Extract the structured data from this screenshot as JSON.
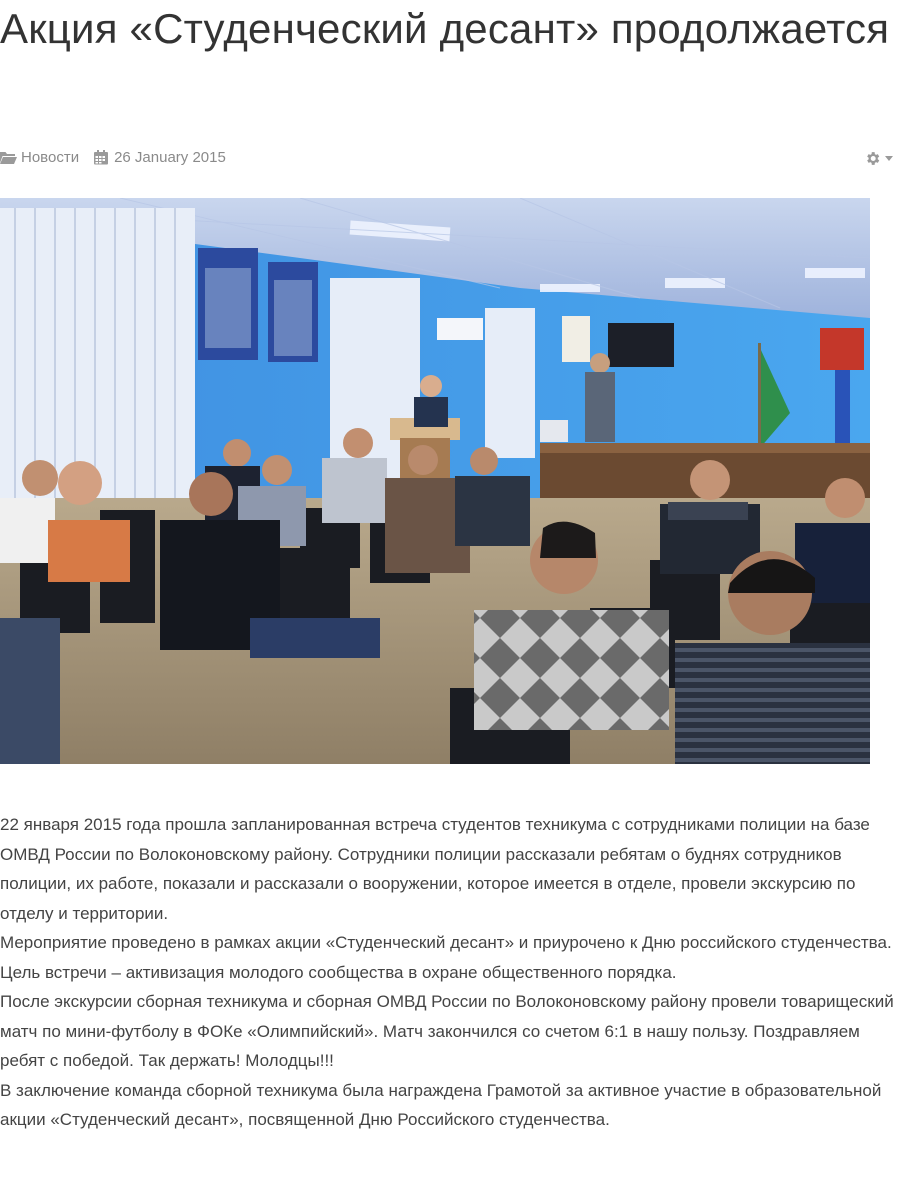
{
  "article": {
    "title": "Акция «Студенческий десант» продолжается",
    "meta": {
      "category_icon": "folder-open-icon",
      "category": "Новости",
      "date_icon": "calendar-icon",
      "date": "26 January 2015",
      "tools_icon": "gear-icon"
    },
    "image": {
      "semantic": "photo-meeting-students-police-hall"
    },
    "paragraphs": [
      "22 января 2015 года прошла запланированная встреча студентов техникума с сотрудниками полиции на базе ОМВД России по Волоконовскому району. Сотрудники полиции рассказали ребятам о буднях сотрудников полиции, их работе, показали и рассказали о вооружении, которое имеется в отделе, провели экскурсию по отделу и территории.",
      "Мероприятие проведено в рамках акции «Студенческий десант» и приурочено к Дню российского студенчества. Цель встречи – активизация молодого сообщества в охране общественного порядка.",
      "После экскурсии сборная техникума и сборная ОМВД России по Волоконовскому району провели товарищеский матч по мини-футболу в ФОКе «Олимпийский». Матч закончился со счетом 6:1 в нашу пользу. Поздравляем ребят с победой. Так держать! Молодцы!!!",
      "В заключение команда сборной техникума была награждена Грамотой за активное участие в образовательной акции «Студенческий десант», посвященной Дню Российского студенчества."
    ]
  }
}
